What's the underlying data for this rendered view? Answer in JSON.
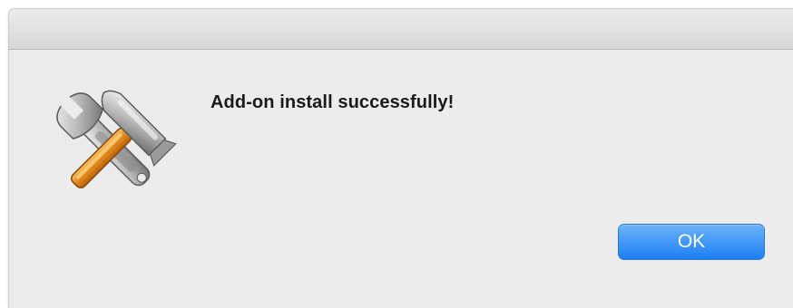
{
  "dialog": {
    "icon": "hammer-wrench-icon",
    "message": "Add-on install successfully!",
    "ok_label": "OK"
  },
  "colors": {
    "button_accent": "#1b7ff3",
    "background": "#ececec"
  }
}
